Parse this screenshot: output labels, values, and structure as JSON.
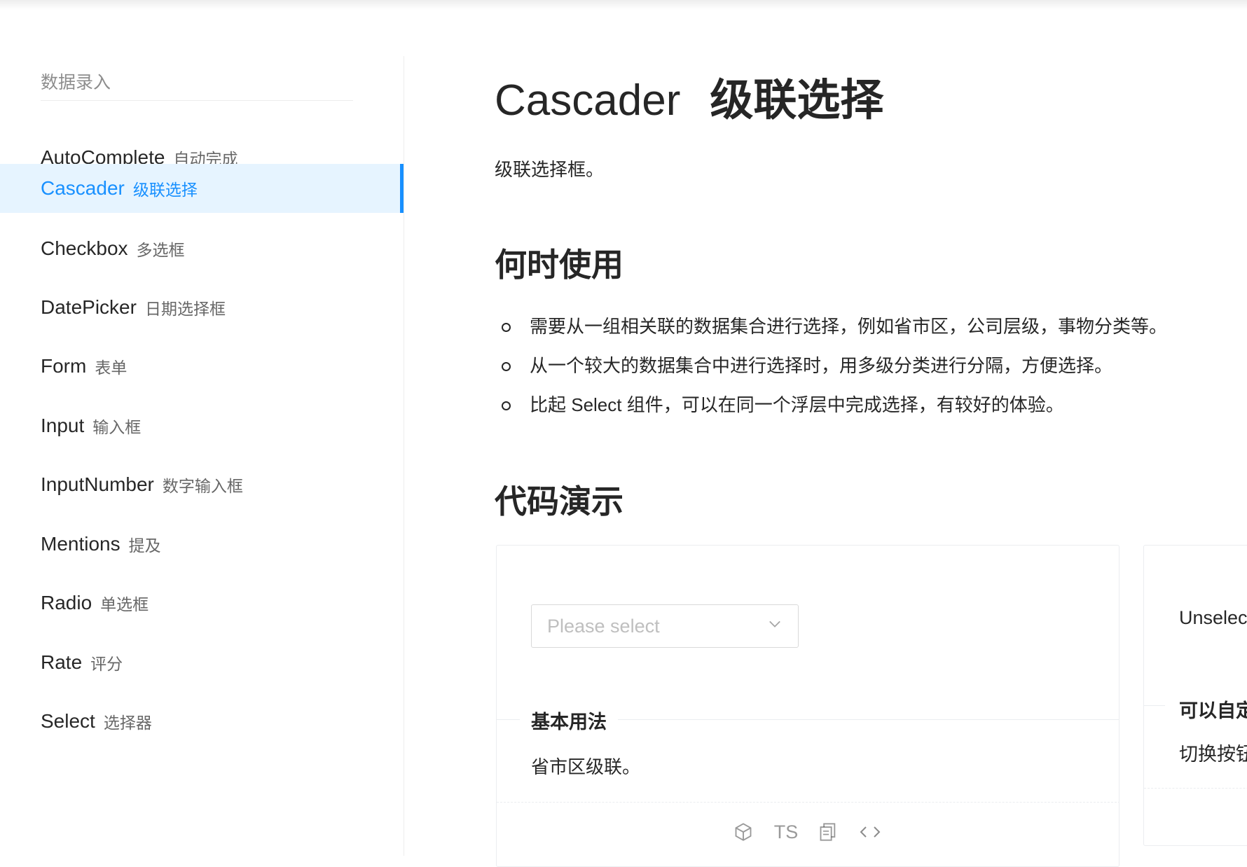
{
  "sidebar": {
    "group_title": "数据录入",
    "items": [
      {
        "en": "AutoComplete",
        "cn": "自动完成"
      },
      {
        "en": "Cascader",
        "cn": "级联选择"
      },
      {
        "en": "Checkbox",
        "cn": "多选框"
      },
      {
        "en": "DatePicker",
        "cn": "日期选择框"
      },
      {
        "en": "Form",
        "cn": "表单"
      },
      {
        "en": "Input",
        "cn": "输入框"
      },
      {
        "en": "InputNumber",
        "cn": "数字输入框"
      },
      {
        "en": "Mentions",
        "cn": "提及"
      },
      {
        "en": "Radio",
        "cn": "单选框"
      },
      {
        "en": "Rate",
        "cn": "评分"
      },
      {
        "en": "Select",
        "cn": "选择器"
      }
    ],
    "active_item": "Cascader"
  },
  "main": {
    "title_en": "Cascader",
    "title_cn": "级联选择",
    "description": "级联选择框。",
    "when_to_use": {
      "heading": "何时使用",
      "items": [
        "需要从一组相关联的数据集合进行选择，例如省市区，公司层级，事物分类等。",
        "从一个较大的数据集合中进行选择时，用多级分类进行分隔，方便选择。",
        "比起 Select 组件，可以在同一个浮层中完成选择，有较好的体验。"
      ]
    },
    "demo_heading": "代码演示"
  },
  "demo1": {
    "placeholder": "Please select",
    "meta_title": "基本用法",
    "meta_desc": "省市区级联。",
    "actions": {
      "ts_label": "TS"
    }
  },
  "demo2": {
    "text": "Unselec",
    "meta_title": "可以自定",
    "meta_desc": "切换按钮"
  },
  "colors": {
    "primary": "#1890ff",
    "active_bg": "#e6f4ff"
  },
  "icons": [
    "chevron-down-icon",
    "codesandbox-icon",
    "copy-icon",
    "code-expand-icon"
  ]
}
